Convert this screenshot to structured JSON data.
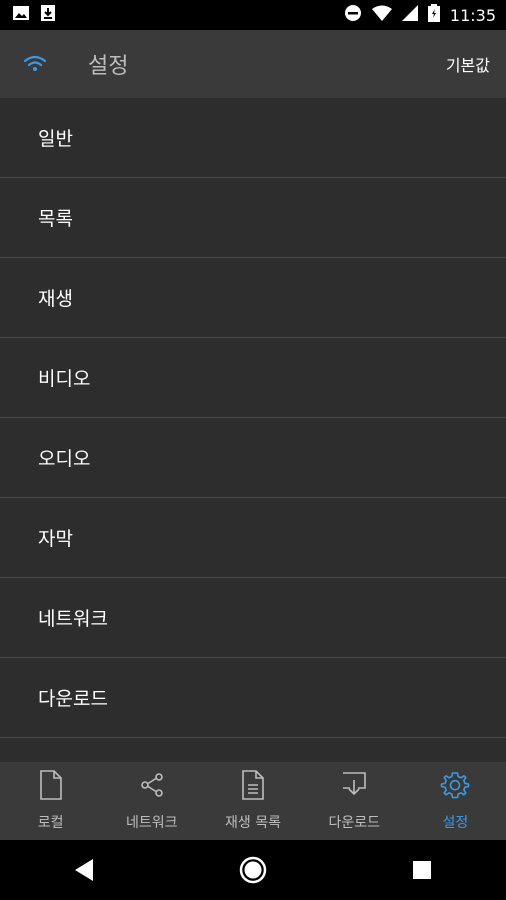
{
  "status_bar": {
    "time": "11:35",
    "icons": [
      "image-icon",
      "download-icon",
      "do-not-disturb-icon",
      "wifi-icon",
      "signal-icon",
      "battery-icon"
    ]
  },
  "app_bar": {
    "title": "설정",
    "action_label": "기본값",
    "accent_color": "#3d98e6"
  },
  "settings": {
    "items": [
      {
        "label": "일반"
      },
      {
        "label": "목록"
      },
      {
        "label": "재생"
      },
      {
        "label": "비디오"
      },
      {
        "label": "오디오"
      },
      {
        "label": "자막"
      },
      {
        "label": "네트워크"
      },
      {
        "label": "다운로드"
      },
      {
        "label": ""
      }
    ]
  },
  "bottom_nav": {
    "items": [
      {
        "label": "로컬",
        "icon": "file-icon",
        "active": false
      },
      {
        "label": "네트워크",
        "icon": "share-icon",
        "active": false
      },
      {
        "label": "재생 목록",
        "icon": "playlist-icon",
        "active": false
      },
      {
        "label": "다운로드",
        "icon": "download-tray-icon",
        "active": false
      },
      {
        "label": "설정",
        "icon": "gear-icon",
        "active": true
      }
    ]
  }
}
